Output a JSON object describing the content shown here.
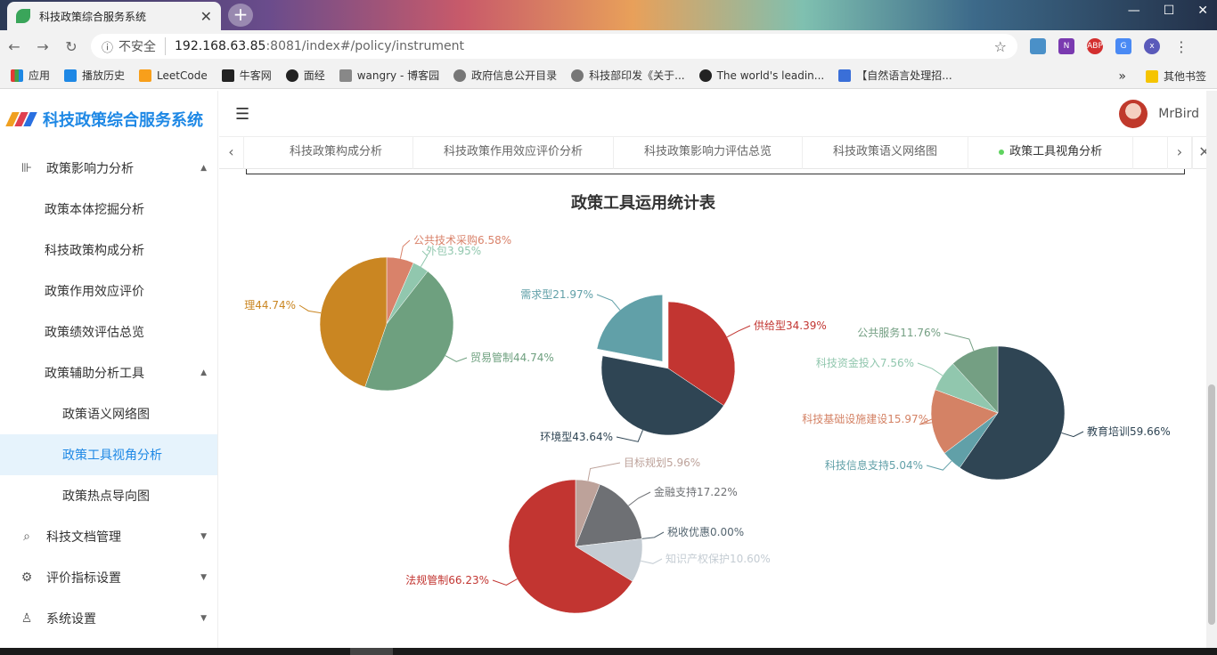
{
  "browser": {
    "tab_title": "科技政策综合服务系统",
    "new_tab": "+",
    "security": "不安全",
    "url_host": "192.168.63.85",
    "url_path": ":8081/index#/policy/instrument",
    "bookmarks": [
      "应用",
      "播放历史",
      "LeetCode",
      "牛客网",
      "面经",
      "wangry - 博客园",
      "政府信息公开目录",
      "科技部印发《关于...",
      "The world's leadin...",
      "【自然语言处理招..."
    ],
    "bookmarks_more": "»",
    "other_bookmarks": "其他书签"
  },
  "app": {
    "title": "科技政策综合服务系统",
    "user": "MrBird"
  },
  "sidebar": {
    "items": [
      {
        "label": "政策影响力分析",
        "level": 1,
        "icon": "chart-icon",
        "arrow": "▲"
      },
      {
        "label": "政策本体挖掘分析",
        "level": 2
      },
      {
        "label": "科技政策构成分析",
        "level": 2
      },
      {
        "label": "政策作用效应评价",
        "level": 2
      },
      {
        "label": "政策绩效评估总览",
        "level": 2
      },
      {
        "label": "政策辅助分析工具",
        "level": 2,
        "arrow": "▲"
      },
      {
        "label": "政策语义网络图",
        "level": 3
      },
      {
        "label": "政策工具视角分析",
        "level": 3,
        "active": true
      },
      {
        "label": "政策热点导向图",
        "level": 3
      },
      {
        "label": "科技文档管理",
        "level": 1,
        "icon": "document-search-icon",
        "arrow": "▼"
      },
      {
        "label": "评价指标设置",
        "level": 1,
        "icon": "gear-icon",
        "arrow": "▼"
      },
      {
        "label": "系统设置",
        "level": 1,
        "icon": "user-icon",
        "arrow": "▼"
      }
    ]
  },
  "tabs": [
    {
      "label": "科技政策构成分析",
      "active": false
    },
    {
      "label": "科技政策作用效应评价分析",
      "active": false
    },
    {
      "label": "科技政策影响力评估总览",
      "active": false
    },
    {
      "label": "科技政策语义网络图",
      "active": false
    },
    {
      "label": "政策工具视角分析",
      "active": true
    }
  ],
  "chart_data": {
    "type": "pie",
    "title": "政策工具运用统计表",
    "charts": [
      {
        "slices": [
          {
            "label": "公共技术采购",
            "value": 6.58,
            "color": "#d9826a"
          },
          {
            "label": "外包",
            "value": 3.95,
            "color": "#91c7ae"
          },
          {
            "label": "贸易管制",
            "value": 44.74,
            "color": "#6ea07f"
          },
          {
            "label": "理",
            "value": 44.74,
            "color": "#ca8622"
          }
        ]
      },
      {
        "slices": [
          {
            "label": "供给型",
            "value": 34.39,
            "color": "#c23531"
          },
          {
            "label": "环境型",
            "value": 43.64,
            "color": "#2f4554"
          },
          {
            "label": "需求型",
            "value": 21.97,
            "color": "#61a0a8"
          }
        ]
      },
      {
        "slices": [
          {
            "label": "教育培训",
            "value": 59.66,
            "color": "#2f4554"
          },
          {
            "label": "科技信息支持",
            "value": 5.04,
            "color": "#61a0a8"
          },
          {
            "label": "科技基础设施建设",
            "value": 15.97,
            "color": "#d48265"
          },
          {
            "label": "科技资金投入",
            "value": 7.56,
            "color": "#91c7ae"
          },
          {
            "label": "公共服务",
            "value": 11.76,
            "color": "#749f83"
          }
        ]
      },
      {
        "slices": [
          {
            "label": "目标规划",
            "value": 5.96,
            "color": "#bda29a"
          },
          {
            "label": "金融支持",
            "value": 17.22,
            "color": "#6e7074"
          },
          {
            "label": "税收优惠",
            "value": 0.0,
            "color": "#546570"
          },
          {
            "label": "知识产权保护",
            "value": 10.6,
            "color": "#c4ccd3"
          },
          {
            "label": "法规管制",
            "value": 66.23,
            "color": "#c23531"
          }
        ]
      }
    ]
  }
}
